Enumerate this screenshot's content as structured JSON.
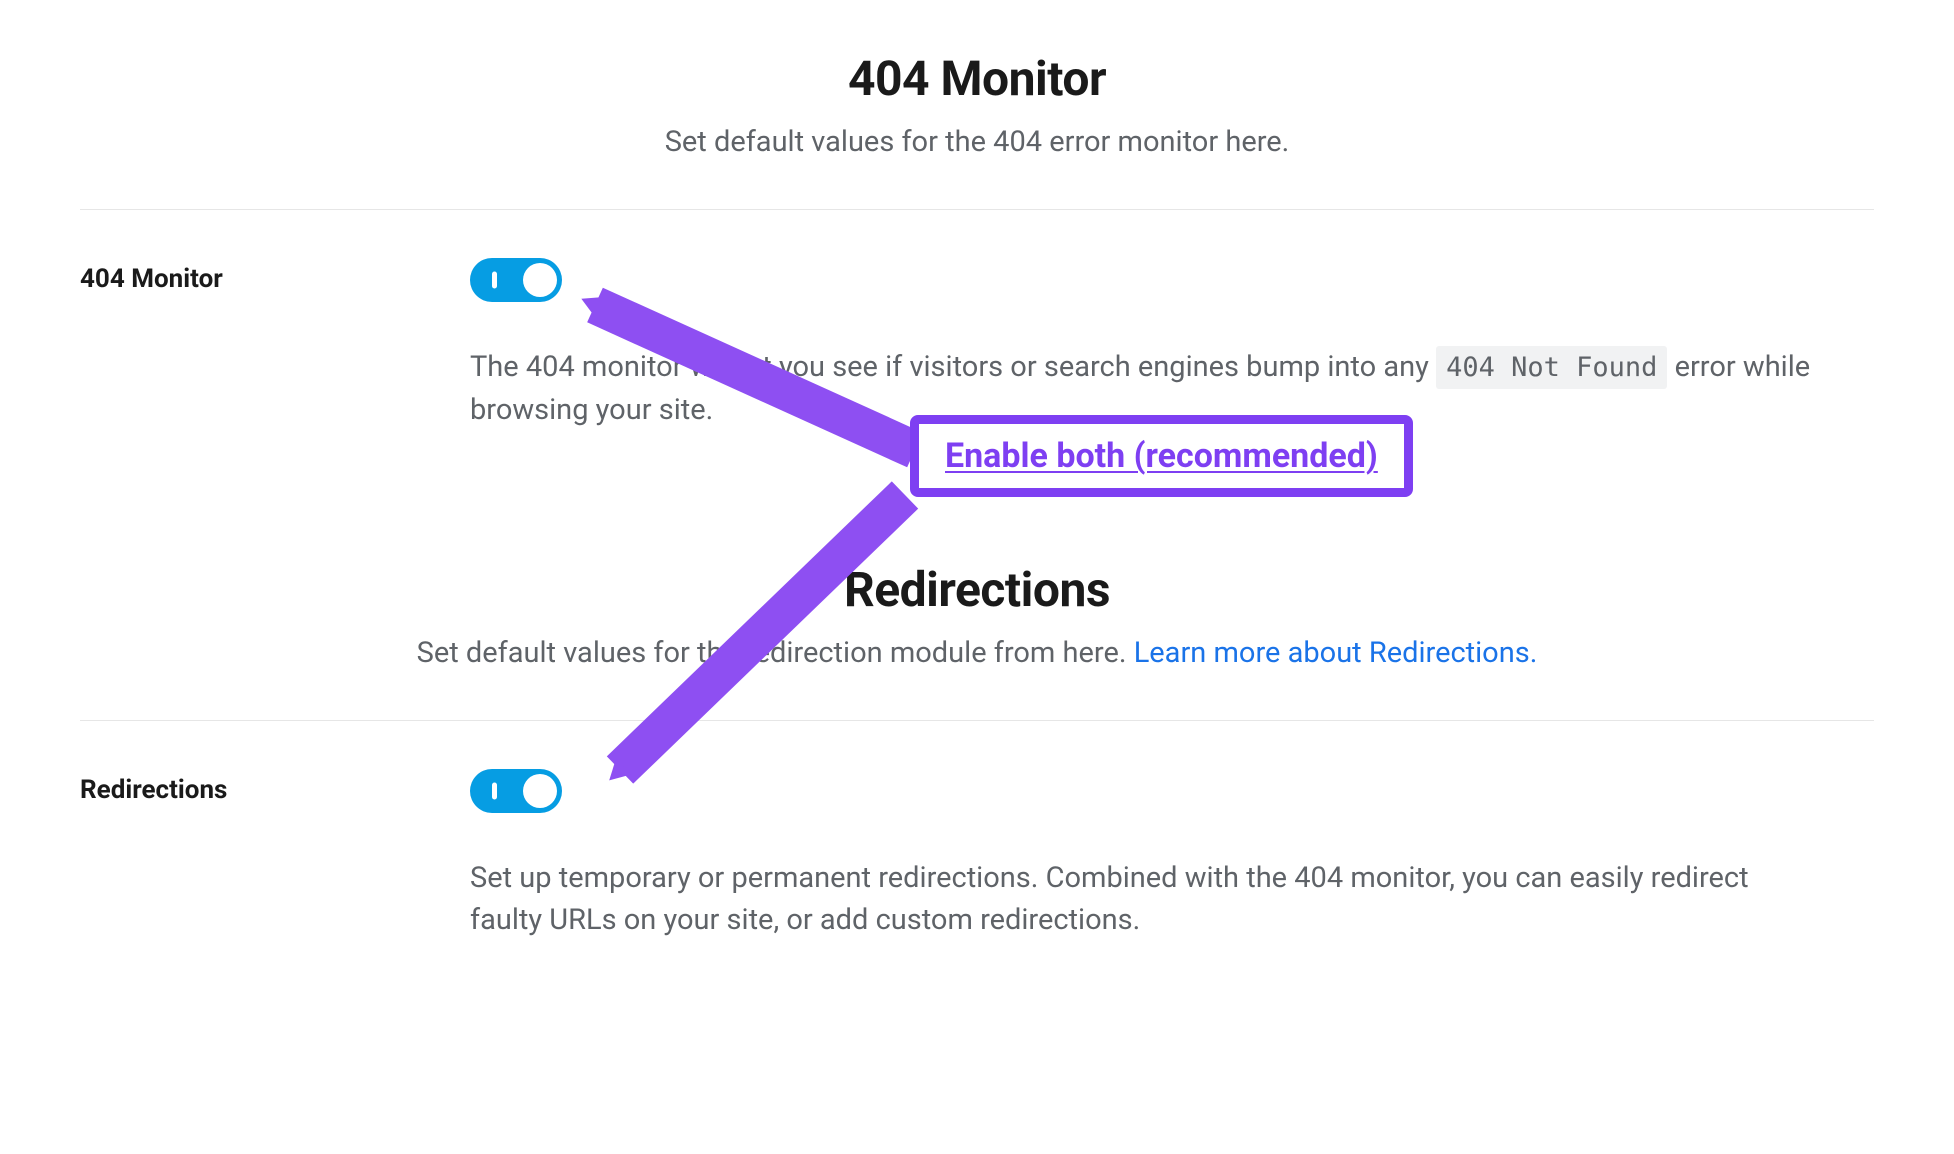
{
  "sections": {
    "monitor": {
      "title": "404 Monitor",
      "subtitle": "Set default values for the 404 error monitor here.",
      "row_label": "404 Monitor",
      "desc_pre": "The 404 monitor will let you see if visitors or search engines bump into any ",
      "code": "404 Not Found",
      "desc_post": " error while browsing your site."
    },
    "redirections": {
      "title": "Redirections",
      "subtitle_pre": "Set default values for the redirection module from here. ",
      "learn_more": "Learn more about Redirections.",
      "row_label": "Redirections",
      "desc": "Set up temporary or permanent redirections. Combined with the 404 monitor, you can easily redirect faulty URLs on your site, or add custom redirections."
    }
  },
  "annotation": {
    "label": "Enable both (recommended)"
  },
  "colors": {
    "accent_purple": "#7e3ff2",
    "toggle_blue": "#069de3",
    "link_blue": "#1a73e8"
  }
}
